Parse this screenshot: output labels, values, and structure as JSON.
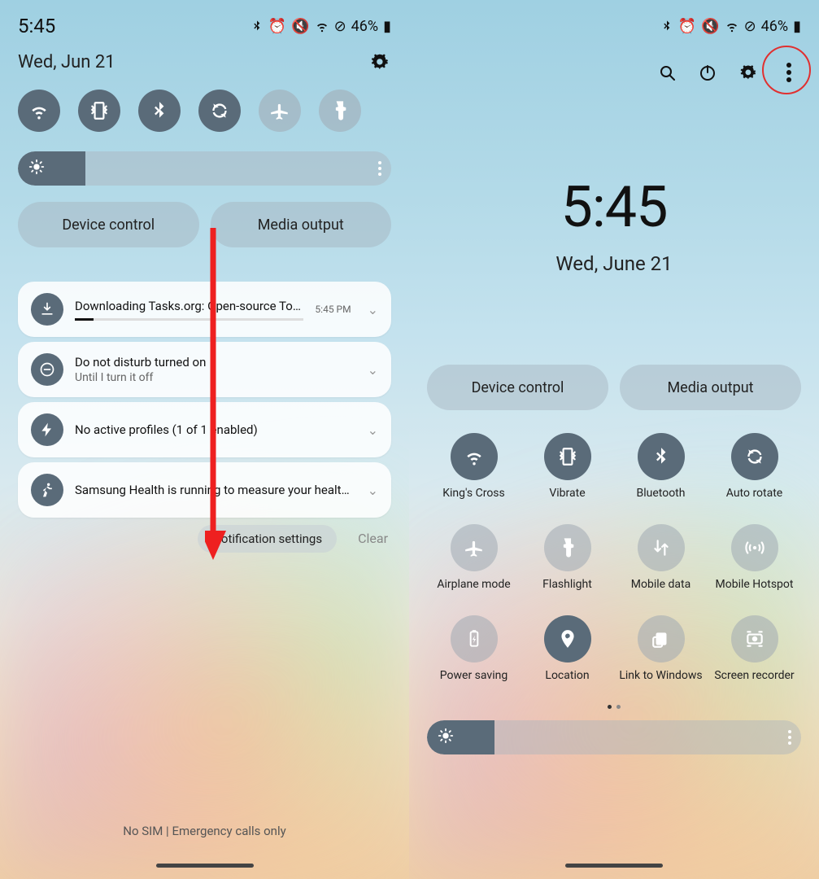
{
  "status": {
    "time": "5:45",
    "battery_pct": "46%"
  },
  "left": {
    "date": "Wed, Jun 21",
    "pills": {
      "device_control": "Device control",
      "media_output": "Media output"
    },
    "notifications": [
      {
        "title": "Downloading Tasks.org: Open-source To-Do Lists &…",
        "time": "5:45 PM",
        "progress": true
      },
      {
        "title": "Do not disturb turned on",
        "sub": "Until I turn it off"
      },
      {
        "title": "No active profiles (1 of 1 enabled)"
      },
      {
        "title": "Samsung Health is running to measure your health data."
      }
    ],
    "actions": {
      "settings": "Notification settings",
      "clear": "Clear"
    },
    "bottom": "No SIM | Emergency calls only"
  },
  "right": {
    "time": "5:45",
    "date": "Wed, June 21",
    "pills": {
      "device_control": "Device control",
      "media_output": "Media output"
    },
    "tiles": [
      {
        "label": "King's Cross",
        "on": true,
        "icon": "wifi"
      },
      {
        "label": "Vibrate",
        "on": true,
        "icon": "vibrate"
      },
      {
        "label": "Bluetooth",
        "on": true,
        "icon": "bluetooth"
      },
      {
        "label": "Auto rotate",
        "on": true,
        "icon": "rotate"
      },
      {
        "label": "Airplane mode",
        "on": false,
        "icon": "airplane"
      },
      {
        "label": "Flashlight",
        "on": false,
        "icon": "flashlight"
      },
      {
        "label": "Mobile data",
        "on": false,
        "icon": "mobiledata"
      },
      {
        "label": "Mobile Hotspot",
        "on": false,
        "icon": "hotspot"
      },
      {
        "label": "Power saving",
        "on": false,
        "icon": "power"
      },
      {
        "label": "Location",
        "on": true,
        "icon": "location"
      },
      {
        "label": "Link to Windows",
        "on": false,
        "icon": "link"
      },
      {
        "label": "Screen recorder",
        "on": false,
        "icon": "recorder"
      }
    ]
  }
}
